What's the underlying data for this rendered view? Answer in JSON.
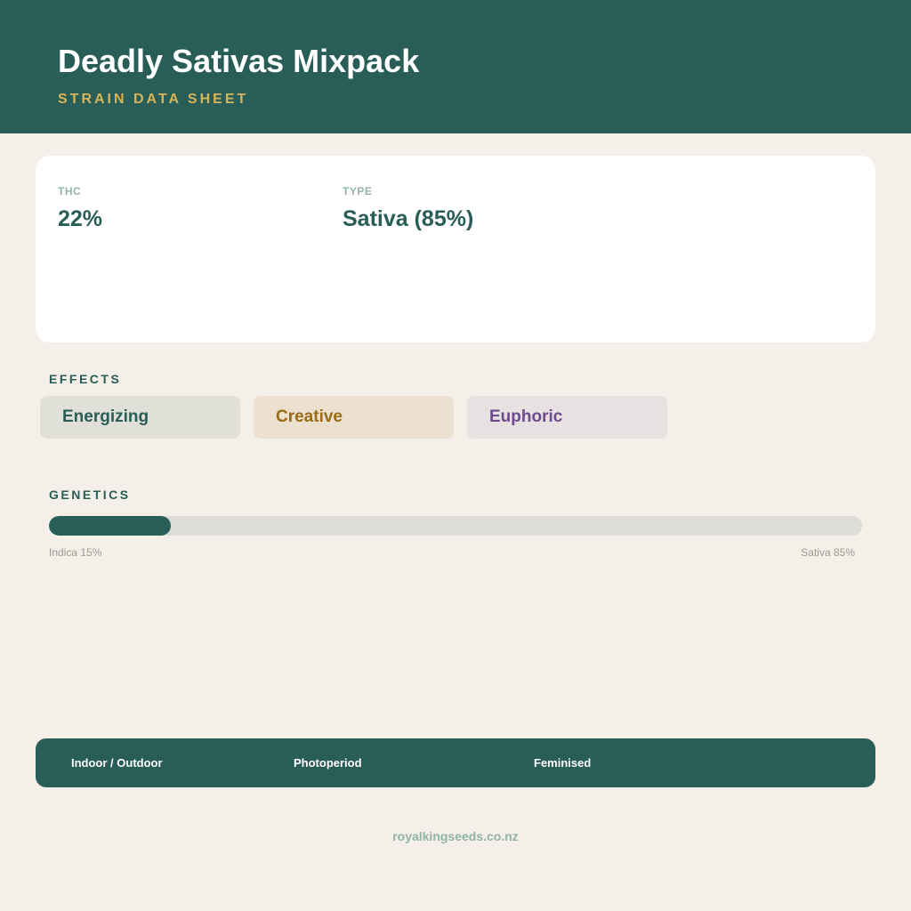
{
  "header": {
    "title": "Deadly Sativas Mixpack",
    "subtitle": "STRAIN DATA SHEET"
  },
  "stats": {
    "thc_label": "THC",
    "thc_value": "22%",
    "type_label": "TYPE",
    "type_value": "Sativa (85%)"
  },
  "effects": {
    "heading": "EFFECTS",
    "items": [
      {
        "label": "Energizing",
        "color": "#285e57",
        "background": "#e0e0d9"
      },
      {
        "label": "Creative",
        "color": "#9a6b12",
        "background": "#ece1d1"
      },
      {
        "label": "Euphoric",
        "color": "#6e4a8e",
        "background": "#e7e1e1"
      }
    ]
  },
  "genetics": {
    "heading": "GENETICS",
    "indica_label": "Indica 15%",
    "sativa_label": "Sativa 85%",
    "indica_fraction": 0.15
  },
  "footer": {
    "grow": "Indoor / Outdoor",
    "flowering": "Photoperiod",
    "sex": "Feminised"
  },
  "website": "royalkingseeds.co.nz",
  "colors": {
    "brand_green": "#285e57",
    "accent_gold": "#d8b35a",
    "background": "#f4efe9"
  }
}
